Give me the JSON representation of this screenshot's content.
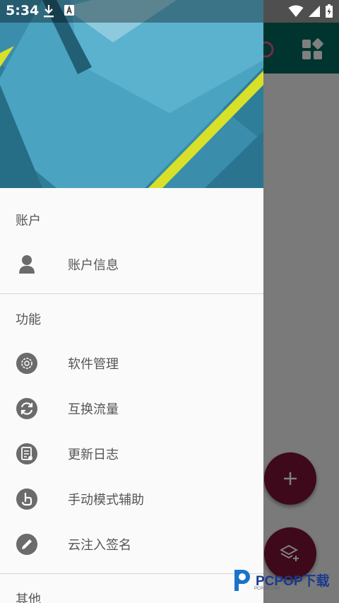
{
  "status_bar": {
    "time": "5:34"
  },
  "drawer": {
    "sections": [
      {
        "title": "账户",
        "items": [
          {
            "label": "账户信息",
            "icon": "person-icon"
          }
        ]
      },
      {
        "title": "功能",
        "items": [
          {
            "label": "软件管理",
            "icon": "gear-icon"
          },
          {
            "label": "互换流量",
            "icon": "swap-icon"
          },
          {
            "label": "更新日志",
            "icon": "log-icon"
          },
          {
            "label": "手动模式辅助",
            "icon": "hand-pointer-icon"
          },
          {
            "label": "云注入签名",
            "icon": "pencil-icon"
          }
        ]
      },
      {
        "title": "其他",
        "items": []
      }
    ]
  },
  "watermark": {
    "brand": "PCPOP下载",
    "sub": "PCPOP.COM"
  },
  "colors": {
    "toolbar": "#00695c",
    "fab": "#7d1335",
    "drawer_bg": "#fafafa",
    "text": "#555555",
    "icon": "#6b6b6b"
  }
}
